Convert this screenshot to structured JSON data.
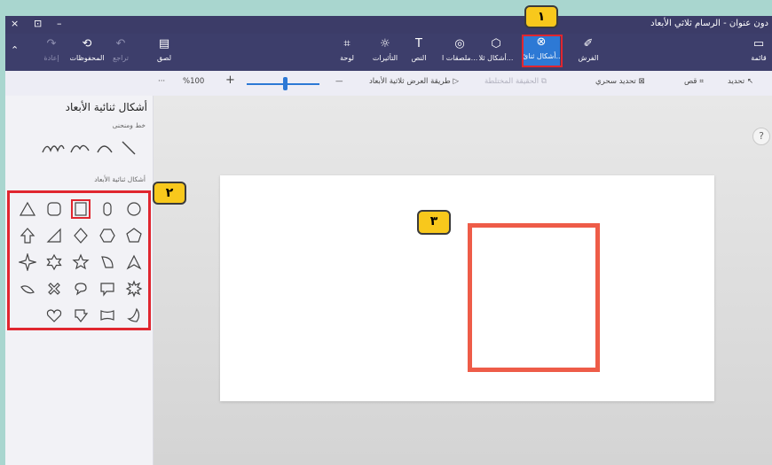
{
  "titlebar": {
    "title": "دون عنوان - الرسام ثلاثي الأبعاد",
    "close_glyph": "×",
    "back_glyph": "⊡",
    "minimize_glyph": "–"
  },
  "ribbon": {
    "collapse_glyph": "⌃",
    "buttons": {
      "redo": {
        "label": "إعادة",
        "icon": "redo-icon"
      },
      "undo": {
        "label": "تراجع",
        "icon": "undo-icon"
      },
      "history": {
        "label": "المحفوظات",
        "icon": "history-icon"
      },
      "paste": {
        "label": "لصق",
        "icon": "paste-icon"
      },
      "canvas": {
        "label": "لوحة",
        "icon": "canvas-icon"
      },
      "effects": {
        "label": "التأثيرات",
        "icon": "effects-icon"
      },
      "text": {
        "label": "النص",
        "icon": "text-icon"
      },
      "stickers": {
        "label": "ملصقات ا...",
        "icon": "stickers-icon"
      },
      "shapes3d": {
        "label": "أشكال ثلا...",
        "icon": "cube-icon"
      },
      "shapes2d": {
        "label": "أشكال ثنائ...",
        "icon": "shapes2d-icon"
      },
      "brushes": {
        "label": "الفرش",
        "icon": "brush-icon"
      },
      "menu": {
        "label": "قائمة",
        "icon": "menu-icon"
      }
    }
  },
  "toolbar": {
    "select": "تحديد",
    "crop": "قص",
    "magic_select": "تحديد سحري",
    "pinned_stickers": "الحقيقة المختلطة",
    "view_3d": "طريقة العرض ثلاثية الأبعاد",
    "zoom": "%100",
    "zoom_in": "+",
    "zoom_out": "—",
    "more": "···"
  },
  "panel": {
    "title": "أشكال ثنائية الأبعاد",
    "lines_label": "خط ومنحنى",
    "shapes_label": "أشكال ثنائية الأبعاد"
  },
  "canvas": {
    "help": "?"
  },
  "callouts": {
    "one": "١",
    "two": "٢",
    "three": "٣"
  },
  "colors": {
    "accent": "#2d79d5",
    "highlight": "#e0262f",
    "shape_stroke": "#ee5c48",
    "callout_fill": "#f8c81c",
    "ribbon": "#3d3e6b"
  }
}
